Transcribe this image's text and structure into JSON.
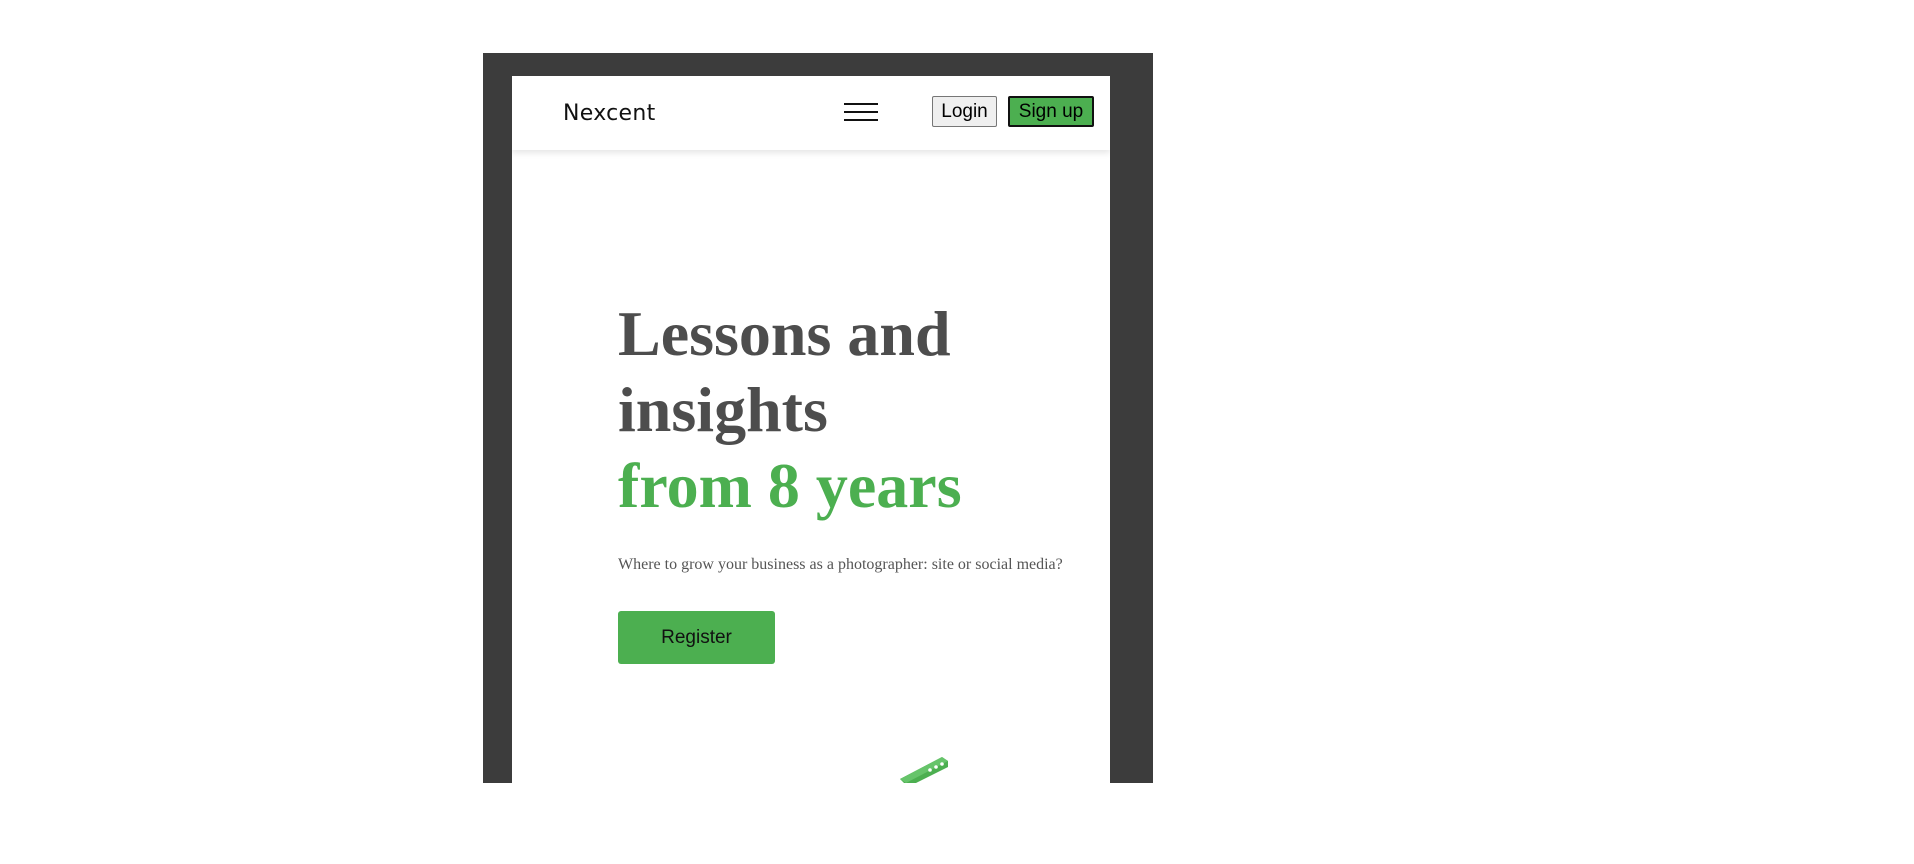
{
  "header": {
    "logo_text": "Nexcent",
    "menu_icon": "hamburger-menu-icon",
    "login_label": "Login",
    "signup_label": "Sign up"
  },
  "hero": {
    "title_line1": "Lessons and",
    "title_line2": "insights",
    "title_accent": "from 8 years",
    "subtitle": "Where to grow your business as a photographer: site or social media?",
    "register_label": "Register",
    "illustration": "isometric-illustration"
  },
  "colors": {
    "accent": "#4caf50",
    "frame": "#3c3c3c",
    "heading": "#4d4d4d",
    "text": "#555555"
  }
}
